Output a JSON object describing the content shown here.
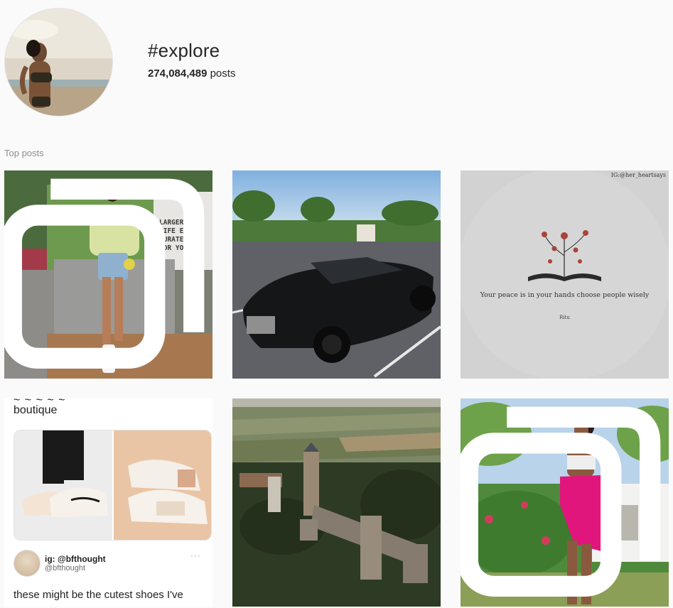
{
  "header": {
    "title": "#explore",
    "post_count": "274,084,489",
    "posts_label": "posts"
  },
  "section": {
    "label": "Top posts"
  },
  "posts": {
    "p1": {
      "wall_sign": "LARGER TH\nLIFE EXPER\nCURATED F\nFOR YOU!"
    },
    "p3": {
      "credit": "IG:@her_heartsays",
      "quote": "Your peace is in your hands choose people wisely",
      "author": "Ritu"
    },
    "p4": {
      "cut_text": "~ ~ ~ ~ ~",
      "top_text": "boutique",
      "tweet_name": "ig: @bfthought",
      "tweet_handle": "@bfthought",
      "tweet_more": "···",
      "tweet_body": "these might be the cutest shoes I've"
    }
  },
  "icons": {
    "multi_post": "carousel-icon"
  },
  "colors": {
    "background": "#fafafa",
    "text": "#262626",
    "muted": "#8e8e8e"
  }
}
